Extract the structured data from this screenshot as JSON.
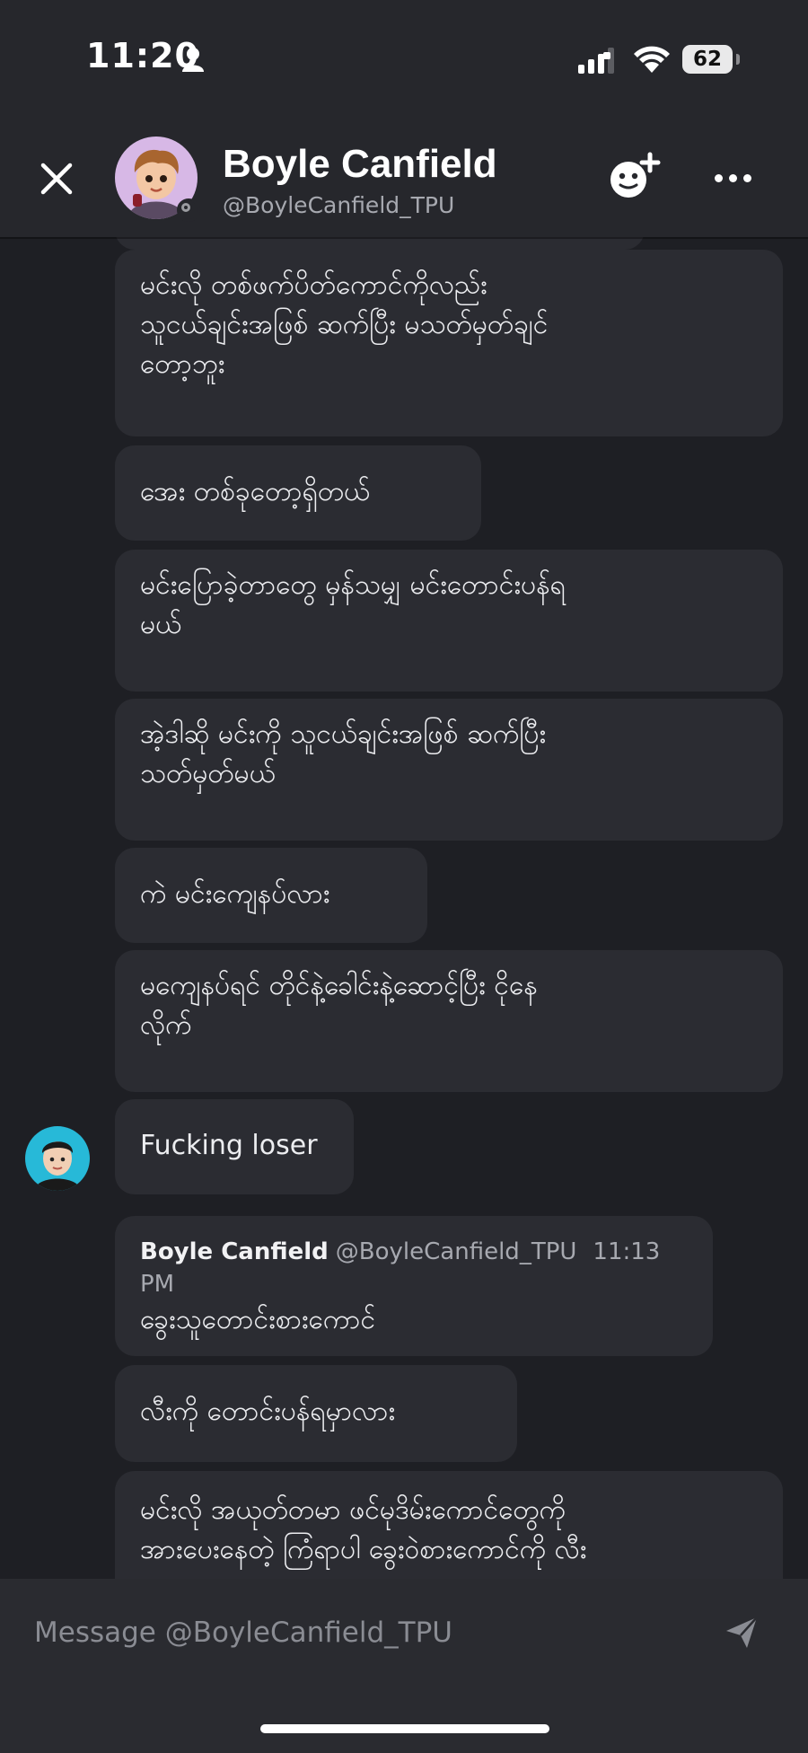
{
  "status_bar": {
    "time": "11:20",
    "battery": "62"
  },
  "header": {
    "title": "Boyle Canfield",
    "handle": "@BoyleCanfield_TPU"
  },
  "messages": [
    {
      "text": "မင်းလို တစ်ဖက်ပိတ်ကောင်ကိုလည်း\nသူငယ်ချင်းအဖြစ် ဆက်ပြီး မသတ်မှတ်ချင်\nတော့ဘူး"
    },
    {
      "text": "အေး တစ်ခုတော့ရှိတယ်"
    },
    {
      "text": "မင်းပြောခဲ့တာတွေ မှန်သမျှ မင်းတောင်းပန်ရ\nမယ်"
    },
    {
      "text": "အဲ့ဒါဆို မင်းကို သူငယ်ချင်းအဖြစ် ဆက်ပြီး\nသတ်မှတ်မယ်"
    },
    {
      "text": "ကဲ မင်းကျေနပ်လား"
    },
    {
      "text": "မကျေနပ်ရင် တိုင်နဲ့ခေါင်းနဲ့ဆောင့်ပြီး ငိုနေ\nလိုက်"
    },
    {
      "text": "Fucking loser"
    },
    {
      "quote_name": "Boyle Canfield",
      "quote_handle": "@BoyleCanfield_TPU",
      "quote_time": "11:13 PM",
      "text": "ခွေးသူတောင်းစားကောင်"
    },
    {
      "text": "လီးကို တောင်းပန်ရမှာလား"
    },
    {
      "text": "မင်းလို အယုတ်တမာ ဖင်မုဒိမ်းကောင်တွေကို\nအားပေးနေတဲ့ ကြံရာပါ ခွေးဝဲစားကောင်ကို လီး"
    }
  ],
  "composer": {
    "placeholder": "Message @BoyleCanfield_TPU"
  },
  "icons": {
    "close": "close-icon",
    "add_friend": "add-friend-icon",
    "more": "more-horizontal-icon",
    "send": "send-icon",
    "wifi": "wifi-icon",
    "signal": "cellular-signal-icon"
  }
}
